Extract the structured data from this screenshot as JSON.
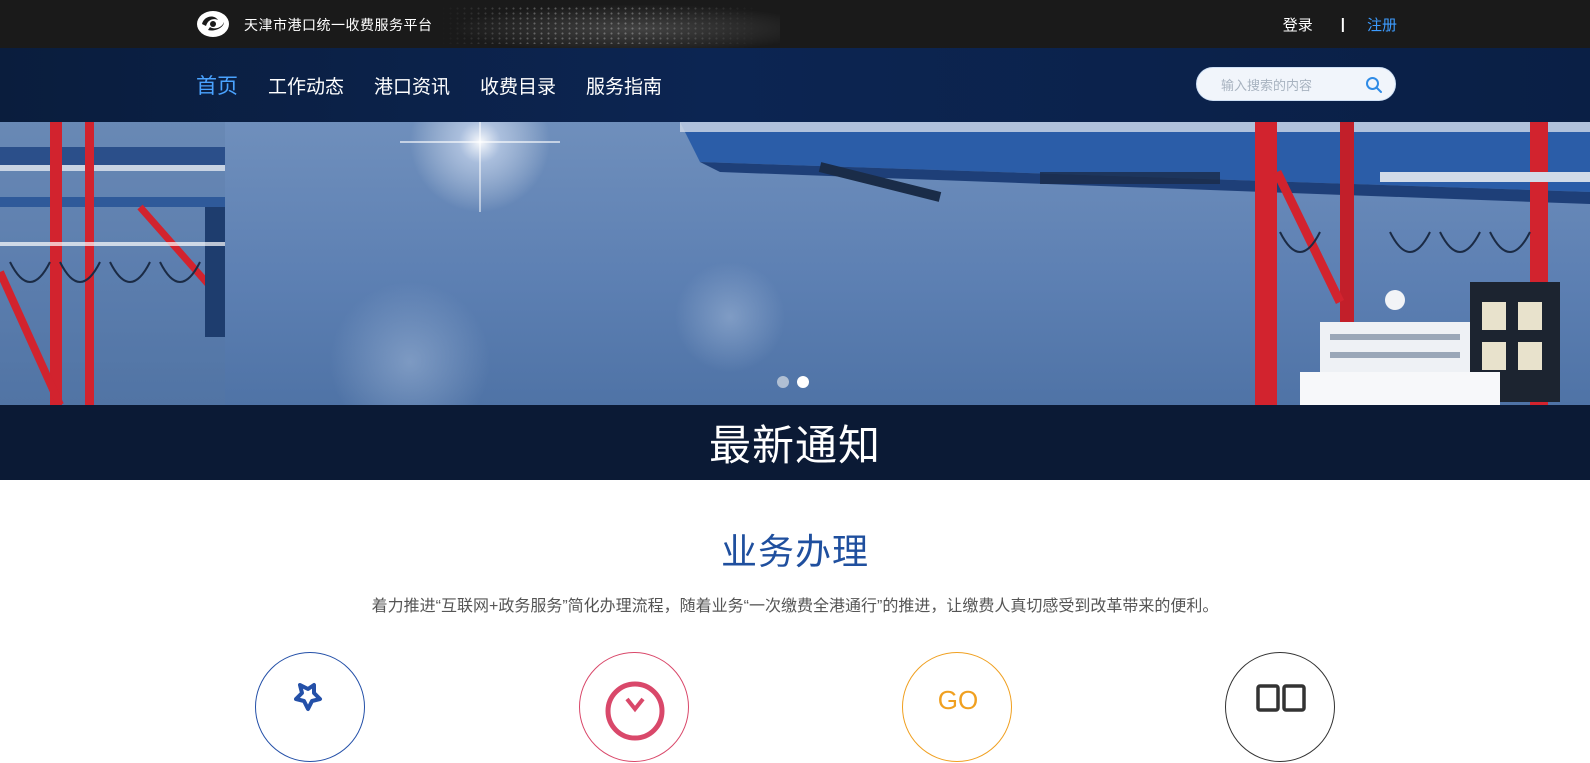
{
  "header": {
    "site_title": "天津市港口统一收费服务平台",
    "login": "登录",
    "separator": "|",
    "register": "注册",
    "logo_icon": "port-logo-icon"
  },
  "nav": {
    "items": [
      {
        "label": "首页",
        "active": true
      },
      {
        "label": "工作动态",
        "active": false
      },
      {
        "label": "港口资讯",
        "active": false
      },
      {
        "label": "收费目录",
        "active": false
      },
      {
        "label": "服务指南",
        "active": false
      }
    ],
    "search_placeholder": "输入搜索的内容",
    "search_icon": "search-icon"
  },
  "banner": {
    "slide_count": 2,
    "active_slide": 2
  },
  "notice": {
    "title": "最新通知"
  },
  "business": {
    "title": "业务办理",
    "description": "着力推进“互联网+政务服务”简化办理流程，随着业务“一次缴费全港通行”的推进，让缴费人真切感受到改革带来的便利。",
    "icons": [
      {
        "name": "star-icon",
        "color": "#2450a8"
      },
      {
        "name": "yen-icon",
        "color": "#d9486a"
      },
      {
        "name": "go-icon",
        "color": "#f0a020",
        "label": "GO"
      },
      {
        "name": "grid-icon",
        "color": "#333333"
      }
    ]
  },
  "colors": {
    "topbar": "#1a1a1a",
    "navbar": "#0c2552",
    "active_nav": "#4aa3ff",
    "notice_bar": "#0b1a35",
    "business_title": "#1f4f9e"
  }
}
